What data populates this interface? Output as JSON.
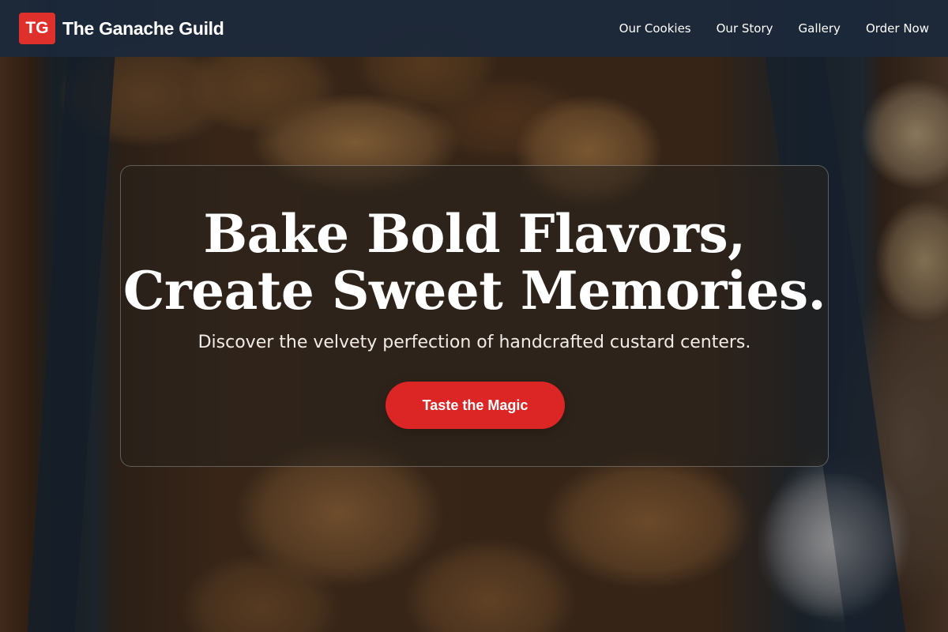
{
  "brand": {
    "logo_text": "TG",
    "name": "The Ganache Guild",
    "logo_color": "#e0302c"
  },
  "nav": {
    "items": [
      {
        "label": "Our Cookies"
      },
      {
        "label": "Our Story"
      },
      {
        "label": "Gallery"
      },
      {
        "label": "Order Now"
      }
    ]
  },
  "hero": {
    "title_line1": "Bake Bold Flavors,",
    "title_line2": "Create Sweet Memories.",
    "subtitle": "Discover the velvety perfection of handcrafted custard centers.",
    "cta_label": "Taste the Magic",
    "cta_color": "#dc2626",
    "background": "cookie-box-photo"
  }
}
